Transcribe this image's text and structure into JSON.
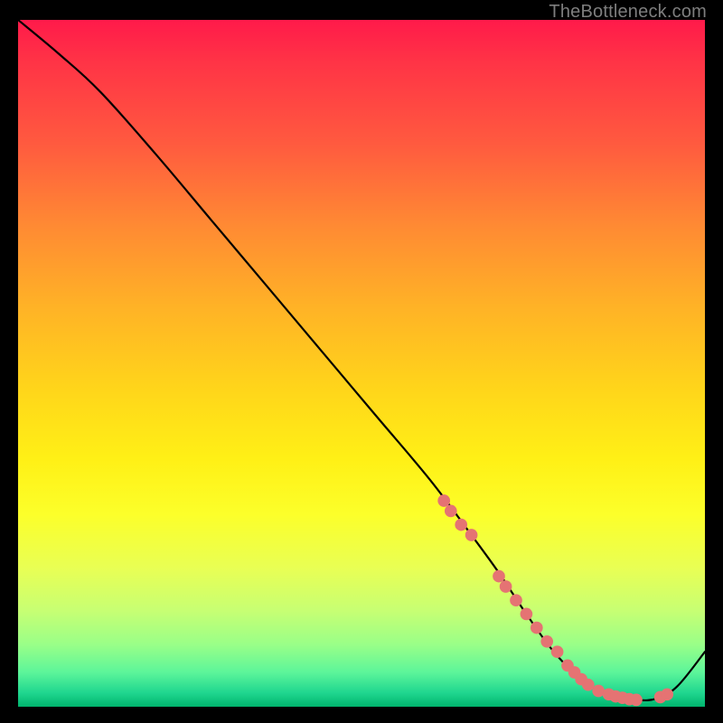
{
  "watermark": "TheBottleneck.com",
  "chart_data": {
    "type": "line",
    "title": "",
    "xlabel": "",
    "ylabel": "",
    "xlim": [
      0,
      100
    ],
    "ylim": [
      0,
      100
    ],
    "series": [
      {
        "name": "curve",
        "color": "#000000",
        "x": [
          0,
          6,
          12,
          20,
          28,
          36,
          44,
          52,
          60,
          66,
          70,
          74,
          78,
          82,
          86,
          90,
          93,
          96,
          100
        ],
        "y": [
          100,
          95,
          89.5,
          80.5,
          71,
          61.5,
          52,
          42.5,
          33,
          25,
          19.5,
          13.5,
          8,
          4,
          1.7,
          1,
          1.2,
          3,
          8
        ]
      }
    ],
    "markers": {
      "name": "salmon-dots",
      "color": "#e57373",
      "radius_pct": 0.9,
      "x": [
        62,
        63,
        64.5,
        66,
        70,
        71,
        72.5,
        74,
        75.5,
        77,
        78.5,
        80,
        81,
        82,
        83,
        84.5,
        86,
        87,
        88,
        89,
        90,
        93.5,
        94.5
      ],
      "y": [
        30,
        28.5,
        26.5,
        25,
        19,
        17.5,
        15.5,
        13.5,
        11.5,
        9.5,
        8,
        6,
        5,
        4,
        3.2,
        2.3,
        1.8,
        1.5,
        1.3,
        1.1,
        1.0,
        1.4,
        1.8
      ]
    }
  }
}
